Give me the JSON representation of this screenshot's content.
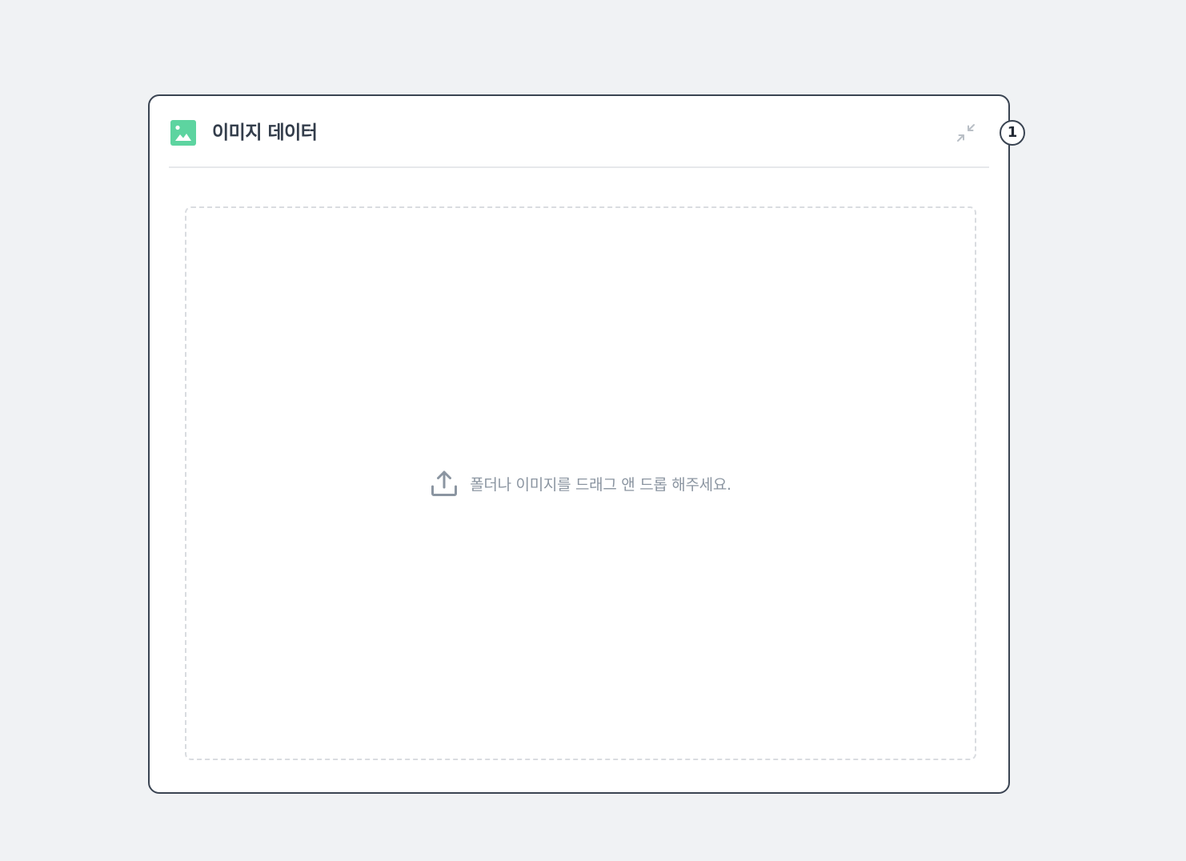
{
  "panel": {
    "title": "이미지 데이터",
    "header_icon": "image-icon",
    "collapse_icon": "collapse-arrows-icon",
    "step_badge": "1"
  },
  "dropzone": {
    "icon": "upload-icon",
    "message": "폴더나 이미지를 드래그 앤 드롭 해주세요."
  },
  "colors": {
    "background": "#f0f2f4",
    "panel_border": "#3a4452",
    "accent_green": "#5dd4a0",
    "title_text": "#333d4b",
    "muted_text": "#8b95a1",
    "dashed_border": "#d9dce0"
  }
}
